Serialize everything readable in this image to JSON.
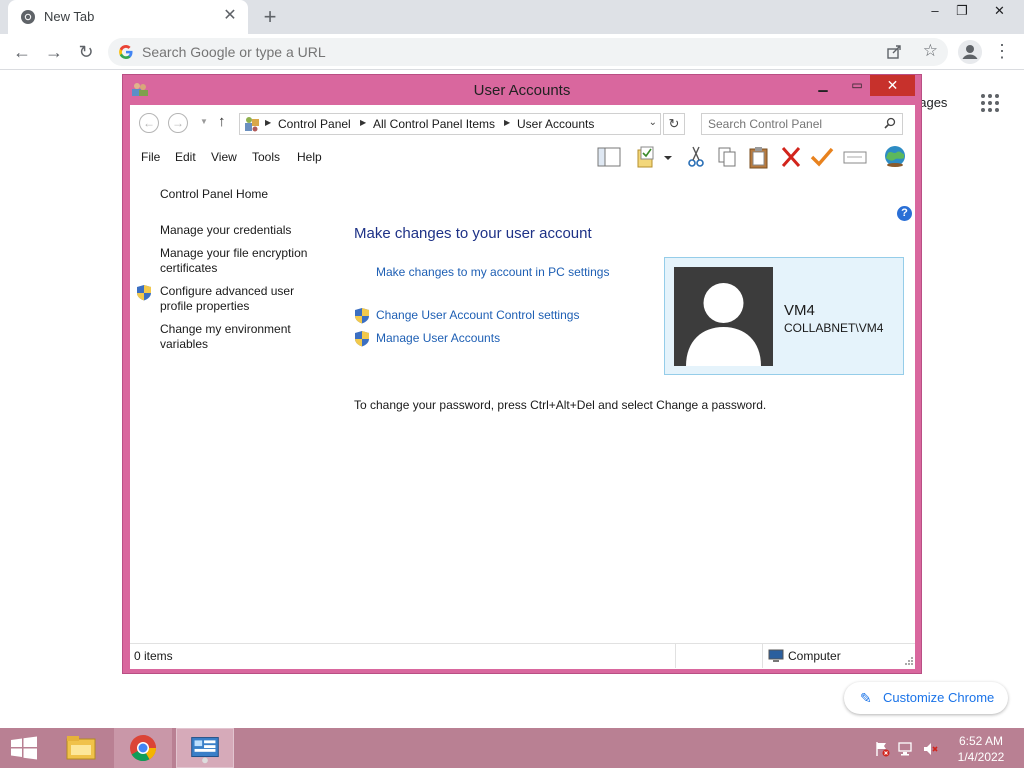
{
  "chrome": {
    "tab_title": "New Tab",
    "tab_close": "✕",
    "new_tab": "+",
    "window_controls": {
      "minimize": "–",
      "maximize": "❐",
      "close": "✕"
    },
    "omnibox_placeholder": "Search Google or type a URL",
    "ntp_images_link": "nages",
    "customize_label": "Customize Chrome"
  },
  "ua_window": {
    "title": "User Accounts",
    "controls": {
      "minimize": "▁",
      "maximize": "▭",
      "close": "✕"
    },
    "address": {
      "crumbs": [
        "Control Panel",
        "All Control Panel Items",
        "User Accounts"
      ],
      "search_placeholder": "Search Control Panel"
    },
    "menu": [
      "File",
      "Edit",
      "View",
      "Tools",
      "Help"
    ],
    "toolbar_icons": [
      "layout-icon",
      "properties-icon",
      "dropdown-icon",
      "cut-icon",
      "copy-icon",
      "paste-icon",
      "delete-icon",
      "check-icon",
      "rename-icon",
      "globe-icon"
    ],
    "left_pane": {
      "home": "Control Panel Home",
      "links": [
        "Manage your credentials",
        "Manage your file encryption certificates",
        "Configure advanced user profile properties",
        "Change my environment variables"
      ]
    },
    "main": {
      "heading": "Make changes to your user account",
      "links": [
        "Make changes to my account in PC settings",
        "Change User Account Control settings",
        "Manage User Accounts"
      ],
      "password_note": "To change your password, press Ctrl+Alt+Del and select Change a password."
    },
    "user": {
      "name": "VM4",
      "domain": "COLLABNET\\VM4"
    },
    "status": {
      "items": "0 items",
      "zone": "Computer"
    }
  },
  "taskbar": {
    "apps": [
      "File Explorer",
      "Google Chrome",
      "Control Panel"
    ],
    "tray_icons": [
      "action-center-flag-icon",
      "network-icon",
      "volume-muted-icon"
    ],
    "time": "6:52 AM",
    "date": "1/4/2022"
  },
  "colors": {
    "window_frame": "#d9679e",
    "close_button": "#c7312c",
    "link_blue": "#1e5fb4",
    "heading_blue": "#1e3287",
    "user_card": "#e5f3fb",
    "taskbar": "#b98093"
  }
}
